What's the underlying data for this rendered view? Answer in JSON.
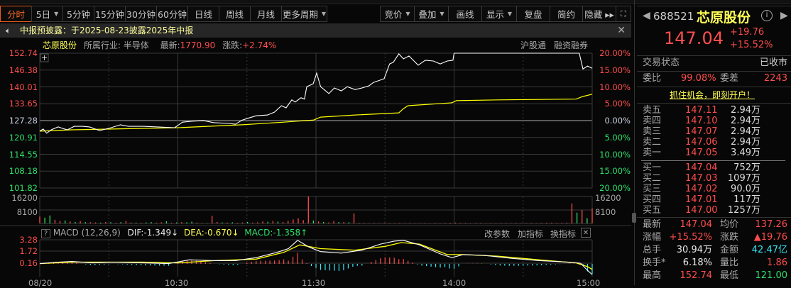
{
  "toolbar": {
    "periods": [
      {
        "label": "分时",
        "active": true
      },
      {
        "label": "5日",
        "caret": true
      },
      {
        "label": "5分钟"
      },
      {
        "label": "15分钟"
      },
      {
        "label": "30分钟"
      },
      {
        "label": "60分钟"
      },
      {
        "label": "日线"
      },
      {
        "label": "周线"
      },
      {
        "label": "月线"
      },
      {
        "label": "更多周期",
        "caret": true
      }
    ],
    "tools": [
      {
        "label": "竞价",
        "caret": true
      },
      {
        "label": "叠加",
        "caret": true
      },
      {
        "label": "画线"
      },
      {
        "label": "显示",
        "caret": true
      },
      {
        "label": "复盘"
      },
      {
        "label": "简约"
      },
      {
        "label": "隐藏 ▸▸"
      }
    ]
  },
  "notice": {
    "text": "中报预披露：于2025-08-23披露2025年中报"
  },
  "info": {
    "name": "芯原股份",
    "industry_label": "所属行业:",
    "industry": "半导体",
    "latest_label": "最新:",
    "latest": "1770.90",
    "change_label": "涨跌:",
    "change": "+2.74%",
    "tags": [
      "沪股通",
      "融资融券"
    ]
  },
  "axes": {
    "price": [
      "152.74",
      "146.38",
      "140.01",
      "133.65",
      "127.28",
      "120.91",
      "114.55",
      "108.18",
      "101.82"
    ],
    "pct": [
      "20.00%",
      "15.00%",
      "10.00%",
      "5.00%",
      "0.00%",
      "5.00%",
      "10.00%",
      "15.00%",
      "20.00%"
    ],
    "vol": [
      "16200",
      "8100"
    ],
    "macd": [
      "3.28",
      "1.72",
      "0.16"
    ],
    "time": [
      "08/20",
      "10:30",
      "11:30",
      "14:00",
      "15:00"
    ]
  },
  "macd_header": {
    "title": "MACD (12,26,9)",
    "dif": "DIF:-1.349↓",
    "dea": "DEA:-0.670↓",
    "macd": "MACD:-1.358↑",
    "buttons": [
      "改参数",
      "加指标",
      "换指标"
    ]
  },
  "chart_data": {
    "type": "line",
    "prev_close": 127.28,
    "ylim": [
      101.82,
      152.74
    ],
    "minutes": 240,
    "price": [
      [
        0,
        123.3
      ],
      [
        1.5,
        124.1
      ],
      [
        3,
        122.5
      ],
      [
        5,
        123.8
      ],
      [
        8,
        124.9
      ],
      [
        10,
        124.3
      ],
      [
        12,
        123.8
      ],
      [
        15,
        125.1
      ],
      [
        18.5,
        125.1
      ],
      [
        21.6,
        124.9
      ],
      [
        26,
        123.5
      ],
      [
        31,
        124.6
      ],
      [
        35,
        125.7
      ],
      [
        38.5,
        125.1
      ],
      [
        45,
        125.1
      ],
      [
        51,
        124.9
      ],
      [
        58.6,
        124.6
      ],
      [
        62,
        126.7
      ],
      [
        66,
        127.0
      ],
      [
        71,
        127.3
      ],
      [
        75.6,
        126.5
      ],
      [
        82,
        126.2
      ],
      [
        85,
        125.9
      ],
      [
        88,
        127.5
      ],
      [
        91,
        128.3
      ],
      [
        94,
        129.1
      ],
      [
        99,
        129.4
      ],
      [
        102,
        130.5
      ],
      [
        105,
        132.9
      ],
      [
        107,
        132.1
      ],
      [
        109.5,
        135.1
      ],
      [
        111,
        134.3
      ],
      [
        113.5,
        135.9
      ],
      [
        115,
        135.4
      ],
      [
        116,
        140.1
      ],
      [
        118.8,
        141.2
      ],
      [
        120.3,
        145.2
      ],
      [
        122,
        140.1
      ],
      [
        125.6,
        137.5
      ],
      [
        128,
        139.6
      ],
      [
        131,
        138.5
      ],
      [
        133.6,
        140.1
      ],
      [
        137,
        139.0
      ],
      [
        140,
        139.6
      ],
      [
        143,
        140.4
      ],
      [
        145,
        141.7
      ],
      [
        149.6,
        143.1
      ],
      [
        152,
        148.7
      ],
      [
        153.6,
        149.3
      ],
      [
        156,
        152.5
      ],
      [
        158,
        150.6
      ],
      [
        160.4,
        151.7
      ],
      [
        164.4,
        148.2
      ],
      [
        167.5,
        150.1
      ],
      [
        171,
        149.8
      ],
      [
        174,
        148.7
      ],
      [
        177,
        149.8
      ],
      [
        179.5,
        150.1
      ],
      [
        180,
        152.74
      ],
      [
        234.4,
        152.74
      ],
      [
        236,
        146.8
      ],
      [
        238,
        147.9
      ],
      [
        240,
        147.04
      ]
    ],
    "avg": [
      [
        0,
        123.3
      ],
      [
        14,
        123.8
      ],
      [
        60,
        124.6
      ],
      [
        88,
        125.7
      ],
      [
        106,
        126.7
      ],
      [
        119,
        127.5
      ],
      [
        122,
        128.6
      ],
      [
        137,
        129.4
      ],
      [
        156,
        130.2
      ],
      [
        158,
        131.8
      ],
      [
        160,
        132.9
      ],
      [
        179,
        134.0
      ],
      [
        181,
        134.8
      ],
      [
        199,
        135.1
      ],
      [
        233,
        135.4
      ],
      [
        236,
        136.4
      ],
      [
        240,
        137.26
      ]
    ],
    "volume": [
      4200,
      3500,
      4800,
      2200,
      1500,
      1800,
      1200,
      900,
      1400,
      800,
      700,
      600,
      500,
      900,
      700,
      400,
      800,
      1500,
      600,
      500,
      400,
      600,
      800,
      500,
      700,
      1300,
      400,
      600,
      800,
      700,
      1100,
      500,
      300,
      200,
      4500,
      900,
      600,
      500,
      700,
      400,
      600,
      900,
      500,
      700,
      1200,
      1000,
      1500,
      1100,
      900,
      1600,
      2400,
      3100,
      2000,
      16200,
      1800,
      1200,
      900,
      600,
      1400,
      800,
      900,
      700,
      6000,
      400,
      300,
      200,
      300,
      200,
      300,
      250,
      200,
      300,
      200,
      300,
      200,
      250,
      300,
      200,
      300,
      200,
      300,
      400,
      500,
      300,
      300,
      200,
      250,
      300,
      200,
      300,
      200,
      250,
      300,
      200,
      300,
      200,
      250,
      300,
      200,
      300,
      400,
      500,
      300,
      400,
      500,
      12000,
      6500,
      8100,
      3200,
      9000
    ],
    "volume_up": [
      true,
      false,
      false,
      true,
      true,
      false,
      true,
      false,
      true,
      false,
      true,
      true,
      false,
      true,
      false,
      true,
      false,
      true,
      true,
      false,
      true,
      false,
      false,
      true,
      true,
      false,
      true,
      false,
      true,
      false,
      false,
      true,
      true,
      false,
      true,
      true,
      false,
      true,
      false,
      true,
      true,
      false,
      true,
      true,
      true,
      false,
      true,
      false,
      true,
      true,
      true,
      true,
      true,
      true,
      false,
      true,
      false,
      true,
      true,
      false,
      true,
      false,
      true,
      true,
      true,
      true,
      true,
      true,
      true,
      true,
      true,
      true,
      true,
      true,
      true,
      true,
      true,
      true,
      true,
      true,
      true,
      true,
      true,
      true,
      true,
      true,
      true,
      true,
      true,
      true,
      true,
      true,
      true,
      true,
      true,
      true,
      true,
      true,
      true,
      true,
      true,
      true,
      true,
      true,
      true,
      true,
      false,
      true,
      false,
      true
    ],
    "macd_ylim": [
      -1.6,
      3.6
    ],
    "dif": [
      [
        0,
        0.1
      ],
      [
        8,
        0.3
      ],
      [
        14,
        0.4
      ],
      [
        23,
        0.2
      ],
      [
        32,
        0.3
      ],
      [
        45,
        0.2
      ],
      [
        56,
        0.1
      ],
      [
        65,
        0.6
      ],
      [
        76,
        0.5
      ],
      [
        85,
        0.5
      ],
      [
        94,
        0.9
      ],
      [
        103,
        1.6
      ],
      [
        108,
        2.1
      ],
      [
        112,
        3.2
      ],
      [
        117,
        2.3
      ],
      [
        122,
        1.7
      ],
      [
        131,
        1.5
      ],
      [
        140,
        1.9
      ],
      [
        148,
        2.7
      ],
      [
        154,
        3.1
      ],
      [
        158,
        3.2
      ],
      [
        165,
        2.6
      ],
      [
        174,
        1.4
      ],
      [
        179,
        0.9
      ],
      [
        184,
        1.3
      ],
      [
        193,
        1.2
      ],
      [
        205,
        0.8
      ],
      [
        217,
        0.5
      ],
      [
        230,
        0.3
      ],
      [
        235,
        0.15
      ],
      [
        238,
        -0.8
      ],
      [
        240,
        -1.349
      ]
    ],
    "dea": [
      [
        0,
        0.1
      ],
      [
        14,
        0.3
      ],
      [
        45,
        0.3
      ],
      [
        60,
        0.2
      ],
      [
        76,
        0.5
      ],
      [
        94,
        0.7
      ],
      [
        106,
        1.6
      ],
      [
        113,
        2.6
      ],
      [
        122,
        2.1
      ],
      [
        137,
        1.9
      ],
      [
        150,
        2.4
      ],
      [
        157,
        2.9
      ],
      [
        165,
        2.7
      ],
      [
        177,
        1.3
      ],
      [
        184,
        1.3
      ],
      [
        199,
        1.1
      ],
      [
        217,
        0.6
      ],
      [
        233,
        0.2
      ],
      [
        238,
        -0.3
      ],
      [
        240,
        -0.67
      ]
    ]
  },
  "quote": {
    "code": "688521",
    "name": "芯原股份",
    "price": "147.04",
    "change": "+19.76",
    "pct": "+15.52%",
    "status_label": "交易状态",
    "status": "已收市",
    "wb_label": "委比",
    "wb": "99.08%",
    "wc_label": "委差",
    "wc": "2243",
    "promo": "抓住机会，即刻开户！"
  },
  "asks": [
    {
      "label": "卖五",
      "price": "147.11",
      "vol": "2.94万"
    },
    {
      "label": "卖四",
      "price": "147.10",
      "vol": "2.94万"
    },
    {
      "label": "卖三",
      "price": "147.07",
      "vol": "2.94万"
    },
    {
      "label": "卖二",
      "price": "147.06",
      "vol": "2.94万"
    },
    {
      "label": "卖一",
      "price": "147.05",
      "vol": "3.49万"
    }
  ],
  "bids": [
    {
      "label": "买一",
      "price": "147.04",
      "vol": "752万"
    },
    {
      "label": "买二",
      "price": "147.03",
      "vol": "1097万"
    },
    {
      "label": "买三",
      "price": "147.02",
      "vol": "90.0万"
    },
    {
      "label": "买四",
      "price": "147.01",
      "vol": "117万"
    },
    {
      "label": "买五",
      "price": "147.00",
      "vol": "1257万"
    }
  ],
  "stats": [
    {
      "l1": "最新",
      "v1": "147.04",
      "c1": "red",
      "l2": "均价",
      "v2": "137.26",
      "c2": "red"
    },
    {
      "l1": "涨幅",
      "v1": "+15.52%",
      "c1": "red",
      "l2": "涨跌",
      "v2": "▲19.76",
      "c2": "red"
    },
    {
      "l1": "总手",
      "v1": "30.94万",
      "c1": "white",
      "l2": "金额",
      "v2": "42.47亿",
      "c2": "cyan"
    },
    {
      "l1": "换手*",
      "v1": "6.18%",
      "c1": "white",
      "l2": "量比",
      "v2": "1.86",
      "c2": "red"
    },
    {
      "l1": "最高",
      "v1": "152.74",
      "c1": "red",
      "l2": "最低",
      "v2": "121.00",
      "c2": "green"
    }
  ]
}
